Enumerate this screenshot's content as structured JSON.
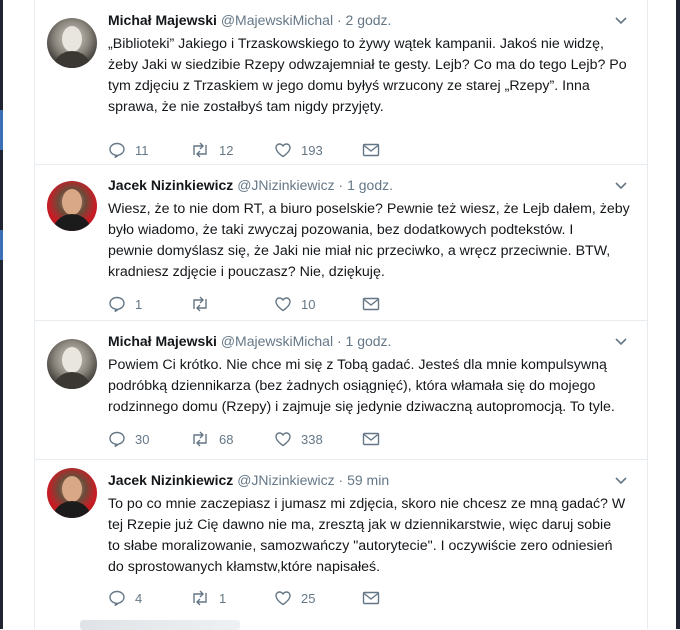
{
  "tweets": [
    {
      "name": "Michał Majewski",
      "handle": "@MajewskiMichal",
      "separator": "·",
      "time": "2 godz.",
      "text": "„Biblioteki” Jakiego i Trzaskowskiego  to żywy wątek kampanii. Jakoś nie widzę,\nżeby Jaki w siedzibie Rzepy odwzajemniał te gesty. Lejb? Co ma do tego Lejb? Po\ntym zdjęciu z Trzaskiem w jego domu byłyś wrzucony ze starej „Rzepy”. Inna\nsprawa, że nie zostałbyś tam nigdy przyjęty.",
      "replies": "11",
      "retweets": "12",
      "likes": "193"
    },
    {
      "name": "Jacek Nizinkiewicz",
      "handle": "@JNizinkiewicz",
      "separator": "·",
      "time": "1 godz.",
      "text": "Wiesz, że to nie dom RT, a biuro poselskie? Pewnie też wiesz, że Lejb dałem, żeby\nbyło wiadomo, że taki zwyczaj pozowania, bez dodatkowych podtekstów. I\npewnie domyślasz się, że Jaki nie miał nic przeciwko, a wręcz przeciwnie. BTW,\nkradniesz zdjęcie i pouczasz? Nie, dziękuję.",
      "replies": "1",
      "retweets": "",
      "likes": "10"
    },
    {
      "name": "Michał Majewski",
      "handle": "@MajewskiMichal",
      "separator": "·",
      "time": "1 godz.",
      "text": "Powiem Ci krótko. Nie chce mi się z Tobą gadać. Jesteś dla mnie kompulsywną\npodróbką dziennikarza (bez żadnych osiągnięć), która włamała się do mojego\nrodzinnego domu (Rzepy) i zajmuje się jedynie dziwaczną autopromocją. To tyle.",
      "replies": "30",
      "retweets": "68",
      "likes": "338"
    },
    {
      "name": "Jacek Nizinkiewicz",
      "handle": "@JNizinkiewicz",
      "separator": "·",
      "time": "59 min",
      "text": "To po co mnie zaczepiasz i jumasz mi zdjęcia, skoro nie chcesz ze mną gadać? W\ntej Rzepie już Cię dawno nie ma, zresztą jak w dziennikarstwie, więc daruj sobie\nto słabe moralizowanie, samozwańczy \"autorytecie\". I oczywiście zero odniesień\ndo sprostowanych kłamstw,które napisałeś.",
      "replies": "4",
      "retweets": "1",
      "likes": "25"
    }
  ],
  "icons": {
    "reply": "reply-icon",
    "retweet": "retweet-icon",
    "like": "heart-icon",
    "dm": "envelope-icon",
    "more": "chevron-down-icon"
  },
  "colors": {
    "text": "#14171a",
    "secondary": "#657786",
    "divider": "#e6ecf0"
  }
}
